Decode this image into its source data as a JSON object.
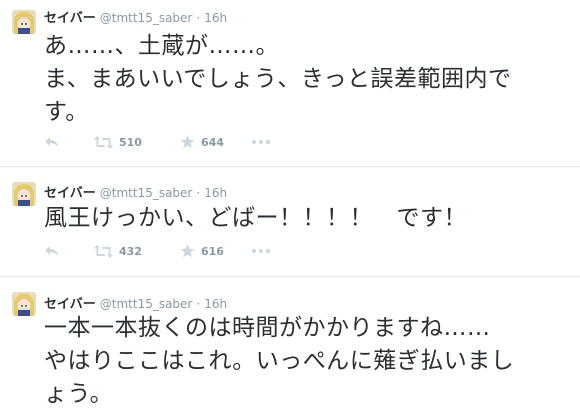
{
  "tweets": [
    {
      "name": "セイバー",
      "handle": "@tmtt15_saber",
      "separator": "·",
      "time": "16h",
      "lines": [
        "あ……、土蔵が……。",
        "ま、まあいいでしょう、きっと誤差範囲内で",
        "す。"
      ],
      "retweets": "510",
      "favorites": "644"
    },
    {
      "name": "セイバー",
      "handle": "@tmtt15_saber",
      "separator": "·",
      "time": "16h",
      "lines": [
        "風王けっかい、どばー！！！！　です！"
      ],
      "retweets": "432",
      "favorites": "616"
    },
    {
      "name": "セイバー",
      "handle": "@tmtt15_saber",
      "separator": "·",
      "time": "16h",
      "lines": [
        "一本一本抜くのは時間がかかりますね……",
        "やはりここはこれ。いっぺんに薙ぎ払いまし",
        "ょう。"
      ]
    }
  ],
  "icons": {
    "avatar": "avatar",
    "reply": "reply-icon",
    "retweet": "retweet-icon",
    "favorite": "star-icon",
    "more": "more-icon"
  },
  "colors": {
    "text": "#292f33",
    "muted": "#8899a6",
    "icon": "#ccd6dd",
    "divider": "#e1e8ed"
  }
}
